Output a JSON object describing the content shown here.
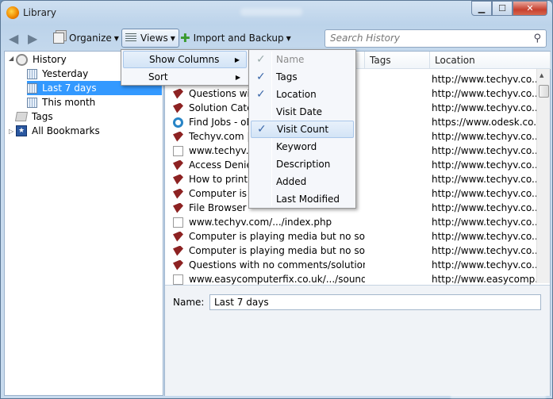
{
  "window": {
    "title": "Library"
  },
  "toolbar": {
    "organize": "Organize",
    "views": "Views",
    "import_backup": "Import and Backup",
    "search_placeholder": "Search History"
  },
  "sidebar": {
    "history": "History",
    "yesterday": "Yesterday",
    "last7": "Last 7 days",
    "this_month": "This month",
    "tags": "Tags",
    "all_bookmarks": "All Bookmarks"
  },
  "columns": {
    "tags": "Tags",
    "location": "Location"
  },
  "rows": [
    {
      "icon": "red",
      "title": "",
      "loc": "http://www.techyv.co..."
    },
    {
      "icon": "red",
      "title": "Questions wit",
      "loc": "http://www.techyv.co..."
    },
    {
      "icon": "red",
      "title": "Solution Cate",
      "loc": "http://www.techyv.co..."
    },
    {
      "icon": "odesk",
      "title": "Find Jobs - oD",
      "loc": "https://www.odesk.co..."
    },
    {
      "icon": "red",
      "title": "Techyv.com |",
      "loc": "http://www.techyv.co..."
    },
    {
      "icon": "page",
      "title": "www.techyv.co",
      "loc": "http://www.techyv.co..."
    },
    {
      "icon": "red",
      "title": "Access Denie",
      "loc": "http://www.techyv.co..."
    },
    {
      "icon": "red",
      "title": "How to print a",
      "loc": "http://www.techyv.co..."
    },
    {
      "icon": "red",
      "title": "Computer is p",
      "loc": "http://www.techyv.co..."
    },
    {
      "icon": "red",
      "title": "File Browser",
      "loc": "http://www.techyv.co..."
    },
    {
      "icon": "page",
      "title": "www.techyv.com/.../index.php",
      "loc": "http://www.techyv.co..."
    },
    {
      "icon": "red",
      "title": "Computer is playing media but no soun...",
      "loc": "http://www.techyv.co..."
    },
    {
      "icon": "red",
      "title": "Computer is playing media but no soun...",
      "loc": "http://www.techyv.co..."
    },
    {
      "icon": "red",
      "title": "Questions with no comments/solutions...",
      "loc": "http://www.techyv.co..."
    },
    {
      "icon": "page",
      "title": "www.easycomputerfix.co.uk/.../soundc...",
      "loc": "http://www.easycomp..."
    }
  ],
  "details": {
    "name_label": "Name:",
    "name_value": "Last 7 days"
  },
  "views_menu": {
    "show_columns": "Show Columns",
    "sort": "Sort"
  },
  "columns_menu": {
    "name": "Name",
    "tags": "Tags",
    "location": "Location",
    "visit_date": "Visit Date",
    "visit_count": "Visit Count",
    "keyword": "Keyword",
    "description": "Description",
    "added": "Added",
    "last_modified": "Last Modified"
  },
  "colors": {
    "selection": "#3399ff",
    "check": "#3966a8"
  }
}
